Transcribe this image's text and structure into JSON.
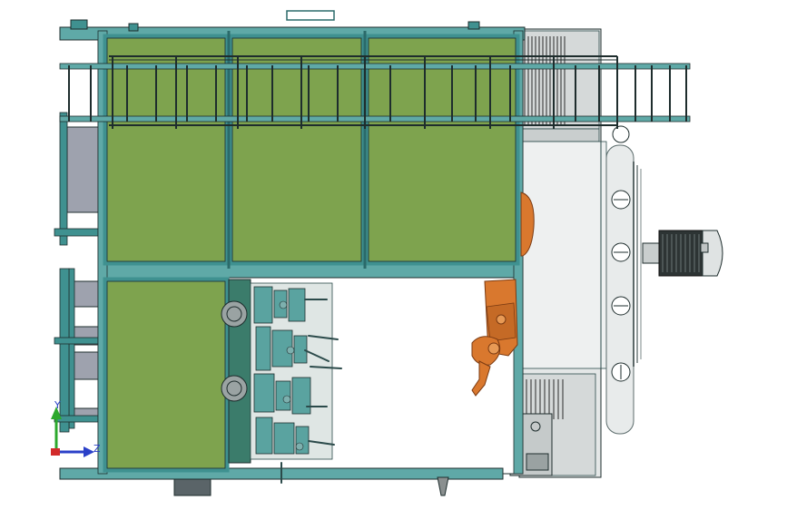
{
  "viewport": {
    "background": "#ffffff"
  },
  "colors": {
    "panel_green": "#7ea34e",
    "frame_teal": "#3f9190",
    "frame_dark": "#2b4a4a",
    "outline": "#1e2d2d",
    "robot_orange": "#d9782e",
    "robot_dark": "#7a3a12",
    "machine_gray": "#d8dcdc",
    "machine_mid": "#b8bebe",
    "motor_dark": "#2d3434",
    "axis_x": "#d22a2a",
    "axis_y": "#2ca82c",
    "axis_z": "#2a40c8"
  },
  "triad": {
    "y_label": "Y",
    "z_label": "Z",
    "x_axis_color_name": "red",
    "y_axis_color_name": "green",
    "z_axis_color_name": "blue"
  },
  "scene": {
    "view": "top view",
    "items": [
      {
        "name": "green-wall-panels",
        "count": 4
      },
      {
        "name": "handrail-platform"
      },
      {
        "name": "fixture-station"
      },
      {
        "name": "industrial-robot"
      },
      {
        "name": "side-machine-cabinet"
      },
      {
        "name": "motor-unit"
      },
      {
        "name": "left-stair-frames",
        "count": 2
      }
    ]
  }
}
